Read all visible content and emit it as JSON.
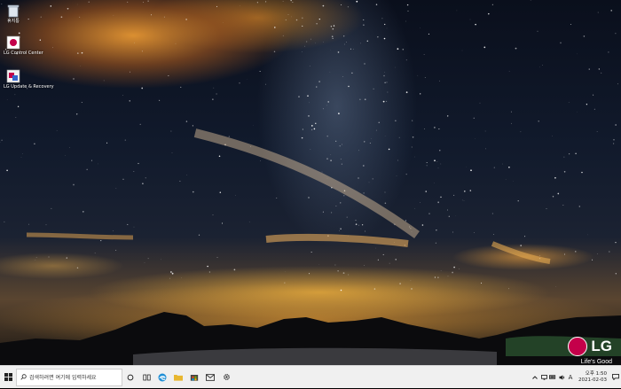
{
  "desktop": {
    "icons": [
      {
        "name": "recycle-bin",
        "label": "휴지통"
      },
      {
        "name": "lg-control-center",
        "label": "LG Control Center"
      },
      {
        "name": "lg-update",
        "label": "LG Update & Recovery"
      }
    ],
    "brand": {
      "logo_text": "LG",
      "tagline": "Life's Good",
      "color": "#c4004a"
    }
  },
  "taskbar": {
    "search_placeholder": "검색하려면 여기에 입력하세요",
    "apps": [
      "search-circle-icon",
      "task-view-icon",
      "edge-icon",
      "file-explorer-icon",
      "store-icon",
      "mail-icon",
      "settings-icon"
    ],
    "tray": {
      "ime": "A",
      "time": "오후 1:50",
      "date": "2021-02-03"
    }
  }
}
